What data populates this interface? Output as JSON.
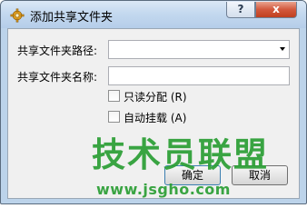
{
  "window": {
    "title": "添加共享文件夹",
    "help_label": "?",
    "close_label": "x"
  },
  "form": {
    "path_label": "共享文件夹路径:",
    "path_value": "",
    "name_label": "共享文件夹名称:",
    "name_value": "",
    "readonly_label": "只读分配",
    "readonly_mnemonic": "(R)",
    "readonly_checked": false,
    "automount_label": "自动挂载",
    "automount_mnemonic": "(A)",
    "automount_checked": false
  },
  "buttons": {
    "ok_label": "确定",
    "cancel_label": "取消"
  },
  "watermark": {
    "text": "技术员联盟",
    "url": "www.jsgho.com"
  },
  "colors": {
    "title_bar": "#c4d9ef",
    "close_button": "#c0401f",
    "watermark": "#2a9e34"
  }
}
